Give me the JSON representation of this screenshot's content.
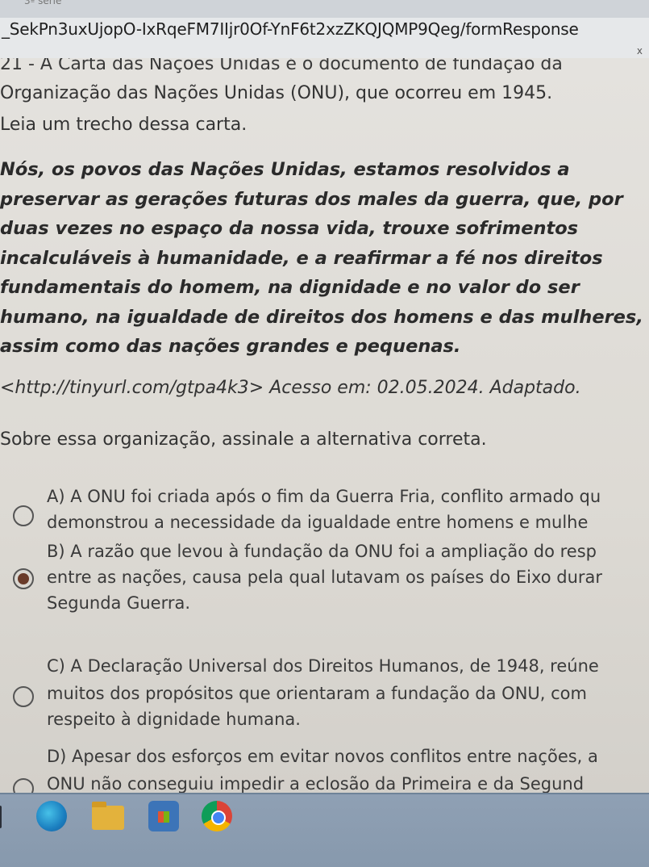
{
  "browser": {
    "top_fragment": "3ª série",
    "url": "_SekPn3uxUjopO-IxRqeFM7IIjr0Of-YnF6t2xzZKQJQMP9Qeg/formResponse",
    "close_symbol": "x"
  },
  "question": {
    "title_line1": "21 - A Carta das Nações Unidas é o documento de fundação da",
    "title_line2": "Organização das Nações Unidas (ONU), que ocorreu em 1945.",
    "lead": "Leia um trecho dessa carta.",
    "quote_lines": [
      "Nós, os povos das Nações Unidas, estamos resolvidos a",
      "preservar as gerações futuras dos males da guerra, que, por",
      "duas vezes no espaço da nossa vida, trouxe sofrimentos",
      "incalculáveis à humanidade, e a reafirmar a fé nos direitos",
      "fundamentais do homem, na dignidade e no valor do ser",
      "humano, na igualdade de direitos dos homens e das mulheres,",
      "assim como das nações grandes e pequenas."
    ],
    "source": "<http://tinyurl.com/gtpa4k3> Acesso em: 02.05.2024. Adaptado.",
    "prompt": "Sobre essa organização, assinale a alternativa correta."
  },
  "options": [
    {
      "lines": [
        "A) A ONU foi criada após o fim da Guerra Fria, conflito armado qu",
        "demonstrou a necessidade da igualdade entre homens e mulhe"
      ],
      "checked": false
    },
    {
      "lines": [
        "B) A razão que levou à fundação da ONU foi a ampliação do resp",
        "entre as nações, causa pela qual lutavam os países do Eixo durar",
        "Segunda Guerra."
      ],
      "checked": true
    },
    {
      "lines": [
        "C) A Declaração Universal dos Direitos Humanos, de 1948, reúne",
        "muitos dos propósitos que orientaram a fundação da ONU, com",
        "respeito à dignidade humana."
      ],
      "checked": false
    },
    {
      "lines": [
        "D) Apesar dos esforços em evitar novos conflitos entre nações, a",
        "ONU não conseguiu impedir a eclosão da Primeira e da Segund"
      ],
      "checked": false
    }
  ],
  "taskbar": {
    "icons": [
      "start-icon",
      "edge-browser-icon",
      "file-explorer-icon",
      "store-icon",
      "chrome-browser-icon"
    ]
  }
}
